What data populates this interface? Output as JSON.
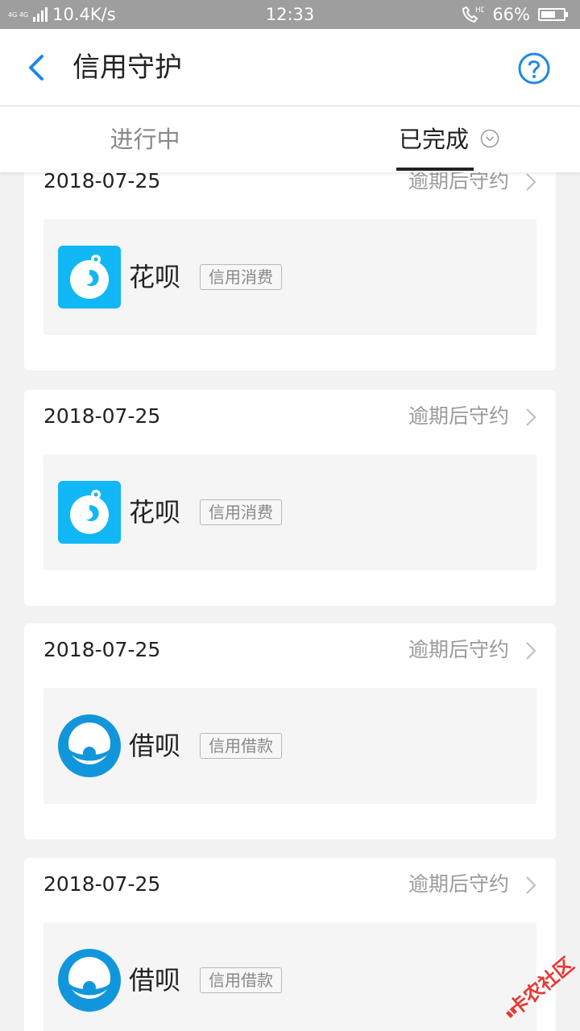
{
  "status_bar": {
    "network": "4G 4G",
    "speed": "10.4K/s",
    "time": "12:33",
    "call_label": "HD",
    "battery": "66%",
    "battery_level": 0.66
  },
  "header": {
    "title": "信用守护",
    "back_icon": "chevron-left-icon",
    "help_icon": "question-circle-icon"
  },
  "tabs": [
    {
      "label": "进行中",
      "active": false
    },
    {
      "label": "已完成",
      "active": true
    }
  ],
  "records": [
    {
      "date": "2018-07-25",
      "status": "逾期后守约",
      "product": "花呗",
      "tag": "信用消费",
      "logo": "huabei-logo"
    },
    {
      "date": "2018-07-25",
      "status": "逾期后守约",
      "product": "花呗",
      "tag": "信用消费",
      "logo": "huabei-logo"
    },
    {
      "date": "2018-07-25",
      "status": "逾期后守约",
      "product": "借呗",
      "tag": "信用借款",
      "logo": "jiebei-logo"
    },
    {
      "date": "2018-07-25",
      "status": "逾期后守约",
      "product": "借呗",
      "tag": "信用借款",
      "logo": "jiebei-logo"
    }
  ],
  "watermark": {
    "text": "卡农社区"
  },
  "colors": {
    "accent": "#1e88e5",
    "huabei": "#12b7f5",
    "jiebei": "#1296db",
    "watermark": "#e53935"
  }
}
